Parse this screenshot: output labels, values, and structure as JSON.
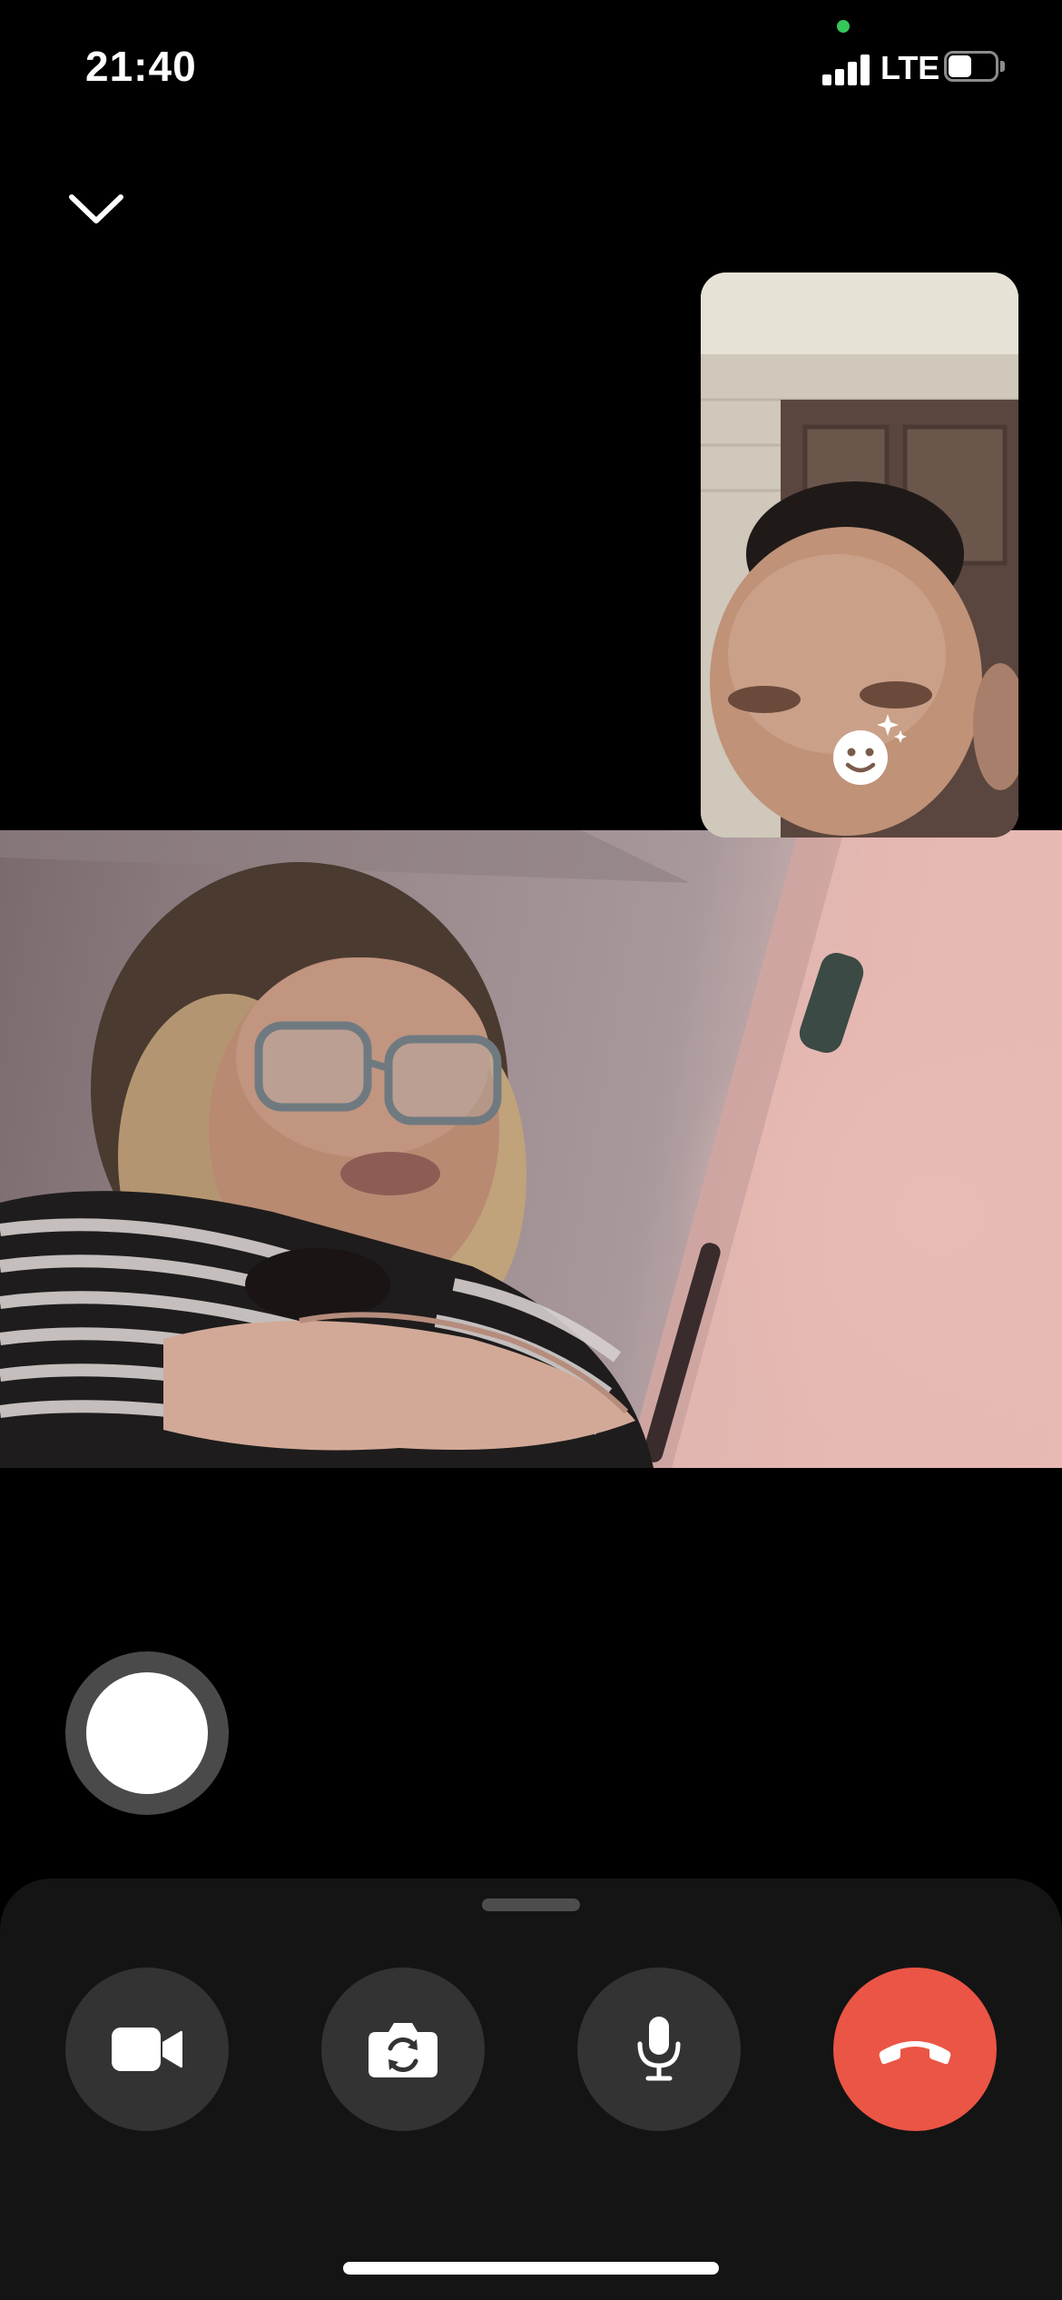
{
  "status_bar": {
    "time": "21:40",
    "network": "LTE",
    "signal_bars_filled": 4,
    "battery_level": 0.5,
    "privacy_indicator_color": "#34c759"
  },
  "call": {
    "minimize_icon": "chevron-down-icon",
    "self_view_effects_icon": "smiley-sparkle-icon",
    "capture_icon": "shutter-icon"
  },
  "controls": {
    "camera_icon": "video-camera-icon",
    "flip_icon": "camera-flip-icon",
    "mic_icon": "microphone-icon",
    "end_call_icon": "phone-hangup-icon",
    "end_call_color": "#eb5545",
    "button_color": "#333333"
  }
}
